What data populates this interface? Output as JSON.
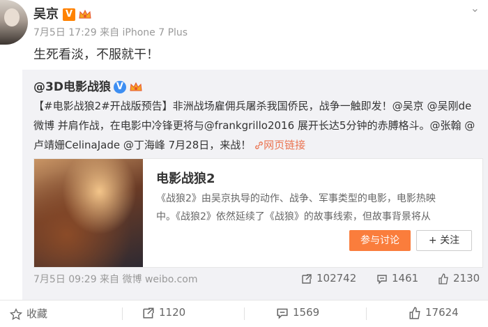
{
  "post": {
    "user_name": "吴京",
    "verified_mark": "V",
    "time": "7月5日 17:29",
    "source_prefix": "来自",
    "source": "iPhone 7 Plus",
    "text": "生死看淡，不服就干！"
  },
  "repost": {
    "user_name": "@3D电影战狼",
    "verified_mark": "V",
    "text_lines": [
      "【#电影战狼2#开战版预告】非洲战场雇佣兵屠杀我国侨民，战争一触即发！@吴京 @吴刚de",
      "微博 并肩作战，在电影中冷锋更将与@frankgrillo2016 展开长达5分钟的赤膊格斗。@张翰 @",
      "卢靖姗CelinaJade @丁海峰 7月28日，来战！"
    ],
    "web_link": "网页链接",
    "card": {
      "title": "电影战狼2",
      "desc_lines": [
        "《战狼2》由吴京执导的动作、战争、军事类型的电影，电影热映",
        "中。《战狼2》依然延续了《战狼》的故事线索，但故事背景将从"
      ],
      "join_label": "参与讨论",
      "follow_label": "+ 关注"
    },
    "meta": "7月5日 09:29 来自 微博 weibo.com",
    "reposts": "102742",
    "comments": "1461",
    "likes": "2130"
  },
  "actions": {
    "favorite": "收藏",
    "forward": "1120",
    "comment": "1569",
    "like": "17624"
  },
  "colors": {
    "accent": "#fa7d3c",
    "link": "#eb7350",
    "verified_orange": "#ff8200",
    "verified_blue": "#3d8ef2"
  }
}
